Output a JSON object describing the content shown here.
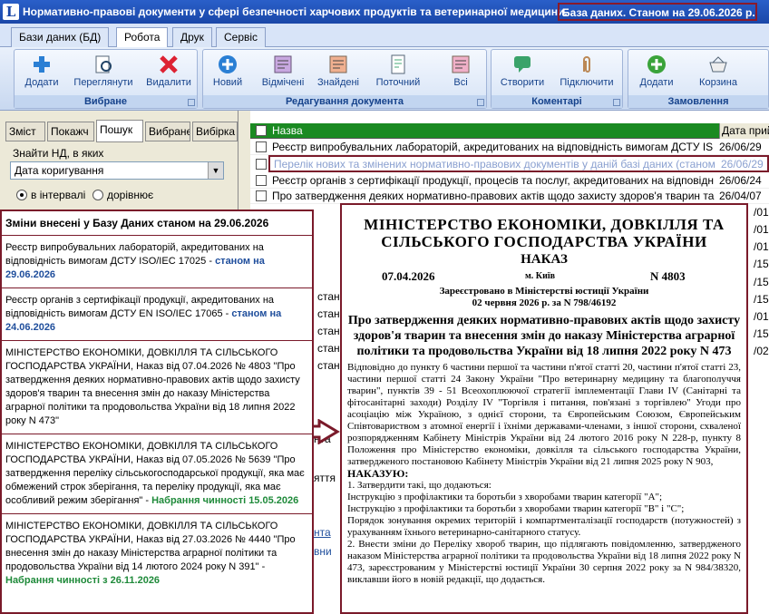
{
  "window": {
    "title": "Нормативно-правові документи у сфері безпечності харчових продуктів та ветеринарної медицини.",
    "db_status": "База даних. Станом на 29.06.2026 р."
  },
  "menu_tabs": [
    "Бази даних (БД)",
    "Робота",
    "Друк",
    "Сервіс"
  ],
  "ribbon": {
    "groups": [
      {
        "title": "Вибране",
        "buttons": [
          "Додати",
          "Переглянути",
          "Видалити"
        ]
      },
      {
        "title": "Редагування документа",
        "buttons": [
          "Новий",
          "Відмічені",
          "Знайдені",
          "Поточний",
          "Всі"
        ]
      },
      {
        "title": "Коментарі",
        "buttons": [
          "Створити",
          "Підключити"
        ]
      },
      {
        "title": "Замовлення",
        "buttons": [
          "Додати",
          "Корзина"
        ]
      }
    ]
  },
  "left_tabs": [
    "Зміст",
    "Покажч",
    "Пошук",
    "Вибране",
    "Вибірка"
  ],
  "search": {
    "find_label": "Знайти НД, в яких",
    "field_value": "Дата коригування",
    "radio_interval": "в інтервалі",
    "radio_equal": "дорівнює"
  },
  "news": {
    "header": "Зміни внесені у Базу Даних станом на 29.06.2026",
    "items": [
      {
        "text": "Реєстр випробувальних лабораторій, акредитованих на відповідність вимогам ДСТУ ISO/IEC 17025 - ",
        "tag": "станом на 29.06.2026",
        "kind": "st"
      },
      {
        "text": "Реєстр органів з сертифікації продукції, акредитованих на відповідність вимогам ДСТУ EN ISO/IEC 17065 - ",
        "tag": "станом на 24.06.2026",
        "kind": "st"
      },
      {
        "text": "МІНІСТЕРСТВО ЕКОНОМІКИ, ДОВКІЛЛЯ ТА СІЛЬСЬКОГО ГОСПОДАРСТВА УКРАЇНИ, Наказ від 07.04.2026 № 4803 \"Про затвердження деяких нормативно-правових актів щодо захисту здоров'я тварин та внесення змін до наказу Міністерства аграрної політики та продовольства України від 18 липня 2022 року N 473\"",
        "tag": "",
        "kind": ""
      },
      {
        "text": "МІНІСТЕРСТВО ЕКОНОМІКИ, ДОВКІЛЛЯ ТА СІЛЬСЬКОГО ГОСПОДАРСТВА УКРАЇНИ, Наказ від 07.05.2026 № 5639 \"Про затвердження переліку сільськогосподарської продукції, яка має обмежений строк зберігання, та переліку продукції, яка має особливий режим зберігання\" - ",
        "tag": "Набрання чинності 15.05.2026",
        "kind": "en"
      },
      {
        "text": "МІНІСТЕРСТВО ЕКОНОМІКИ, ДОВКІЛЛЯ ТА СІЛЬСЬКОГО ГОСПОДАРСТВА УКРАЇНИ, Наказ від 27.03.2026 № 4440 \"Про внесення змін до наказу Міністерства аграрної політики та продовольства України від 14 лютого 2024 року N 391\" - ",
        "tag": "Набрання чинності з 26.11.2026",
        "kind": "en"
      }
    ]
  },
  "grid": {
    "col_name": "Назва",
    "col_date": "Дата прий",
    "rows": [
      {
        "t": "Реєстр випробувальних лабораторій, акредитованих на відповідність вимогам ДСТУ IS",
        "d": "26/06/29"
      },
      {
        "t": "Перелік нових та змінених нормативно-правових документів у даній базі даних (станом",
        "d": "26/06/29"
      },
      {
        "t": "Реєстр органів з сертифікації продукції, процесів та послуг, акредитованих на відповідн",
        "d": "26/06/24"
      },
      {
        "t": "Про затвердження деяких нормативно-правових актів щодо захисту здоров'я тварин та",
        "d": "26/04/07"
      }
    ],
    "partial_dates": [
      "/01",
      "/01",
      "/01",
      "/15",
      "/15",
      "/15",
      "/01",
      "/15",
      "/02"
    ],
    "partial_words": [
      "стан",
      "стан",
      "стан",
      "стан",
      "стан",
      "стан"
    ],
    "frags": [
      "нта",
      "яття",
      "нта",
      "вни"
    ]
  },
  "doc": {
    "ministry": "МІНІСТЕРСТВО ЕКОНОМІКИ, ДОВКІЛЛЯ ТА СІЛЬСЬКОГО ГОСПОДАРСТВА УКРАЇНИ",
    "kind": "НАКАЗ",
    "date": "07.04.2026",
    "city": "м. Київ",
    "number": "N 4803",
    "reg1": "Зареєстровано в Міністерстві юстиції України",
    "reg2": "02 червня 2026 р. за N 798/46192",
    "subject": "Про затвердження деяких нормативно-правових актів щодо захисту здоров'я тварин та внесення змін до наказу Міністерства аграрної політики та продовольства України від 18 липня 2022 року N 473",
    "para1": "Відповідно до пункту 6 частини першої та частини п'ятої статті 20, частини п'ятої статті 23, частини першої статті 24 Закону України \"Про ветеринарну медицину та благополуччя тварин\", пунктів 39 - 51 Всеохоплюючої стратегії імплементації Глави IV (Санітарні та фітосанітарні заходи) Розділу IV \"Торгівля і питання, пов'язані з торгівлею\" Угоди про асоціацію між Україною, з однієї сторони, та Європейським Союзом, Європейським Співтовариством з атомної енергії і їхніми державами-членами, з іншої сторони, схваленої розпорядженням Кабінету Міністрів України від 24 лютого 2016 року N 228-р, пункту 8 Положення про Міністерство економіки, довкілля та сільського господарства України, затвердженого постановою Кабінету Міністрів України від 21 липня 2025 року N 903,",
    "nakazuyu": "НАКАЗУЮ:",
    "p1": "1. Затвердити такі, що додаються:",
    "p2": "Інструкцію з профілактики та боротьби з хворобами тварин категорії \"А\";",
    "p3": "Інструкцію з профілактики та боротьби з хворобами тварин категорії \"B\" і \"C\";",
    "p4": "Порядок зонування окремих територій і компартменталізації господарств (потужностей) з урахуванням їхнього ветеринарно-санітарного статусу.",
    "p5": "2. Внести зміни до Переліку хвороб тварин, що підлягають повідомленню, затвердженого наказом Міністерства аграрної політики та продовольства України від 18 липня 2022 року N 473, зареєстрованим у Міністерстві юстиції України 30 серпня 2022 року за N 984/38320, виклавши його в новій редакції, що додається."
  },
  "colors": {
    "accent": "#7a1a2a",
    "grid_header": "#1a8a22",
    "titlebar": "#1a47a8"
  }
}
